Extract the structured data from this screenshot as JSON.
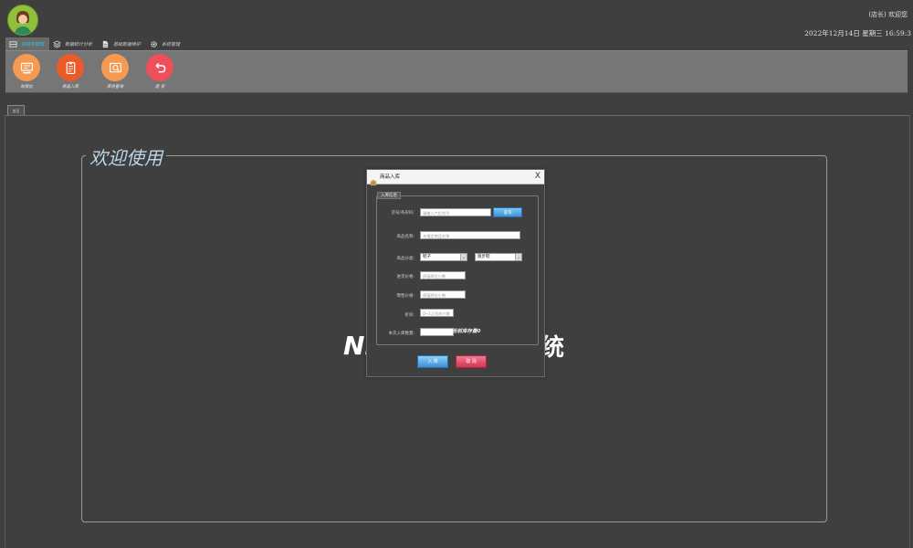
{
  "header": {
    "welcome": "(店长) 欢迎您",
    "datetime": "2022年12月14日  星期三  16:59:3"
  },
  "menu": {
    "tabs": [
      {
        "label": "进销存管理",
        "icon": "inventory-icon",
        "active": true
      },
      {
        "label": "数据统计分析",
        "icon": "layers-icon",
        "active": false
      },
      {
        "label": "基础数据维护",
        "icon": "document-icon",
        "active": false
      },
      {
        "label": "系统管理",
        "icon": "gear-icon",
        "active": false
      }
    ]
  },
  "toolbar": {
    "buttons": [
      {
        "label": "收银台",
        "icon": "cashier-icon",
        "color": "#f49a53"
      },
      {
        "label": "商品入库",
        "icon": "clipboard-icon",
        "color": "#ec5a2a"
      },
      {
        "label": "库存查询",
        "icon": "search-icon",
        "color": "#f49a53"
      },
      {
        "label": "退 货",
        "icon": "return-icon",
        "color": "#ef4f5a"
      }
    ]
  },
  "doc_tab": {
    "label": "首页"
  },
  "welcome": {
    "title": "欢迎使用",
    "system_left": "NI",
    "system_right": "统"
  },
  "dialog": {
    "title": "商品入库",
    "close": "X",
    "group_title": "入库信息",
    "fields": {
      "barcode": {
        "label": "货号/条形码:",
        "placeholder": "请输入六位货号"
      },
      "query_button": "查询",
      "name": {
        "label": "商品名称:",
        "placeholder": "未指定商品名称"
      },
      "category": {
        "label": "商品分类:",
        "value1": "鞋子",
        "value2": "跑步鞋"
      },
      "purchase_price": {
        "label": "进货价格:",
        "placeholder": "保留两位小数"
      },
      "retail_price": {
        "label": "零售价格:",
        "placeholder": "保留两位小数"
      },
      "discount": {
        "label": "折扣:",
        "placeholder": "0~1之间的小数"
      },
      "quantity": {
        "label": "本次入库数量:",
        "value": ""
      },
      "stock_text": "当前库存量0"
    },
    "buttons": {
      "stock_in": "入 库",
      "cancel": "取 消"
    }
  }
}
